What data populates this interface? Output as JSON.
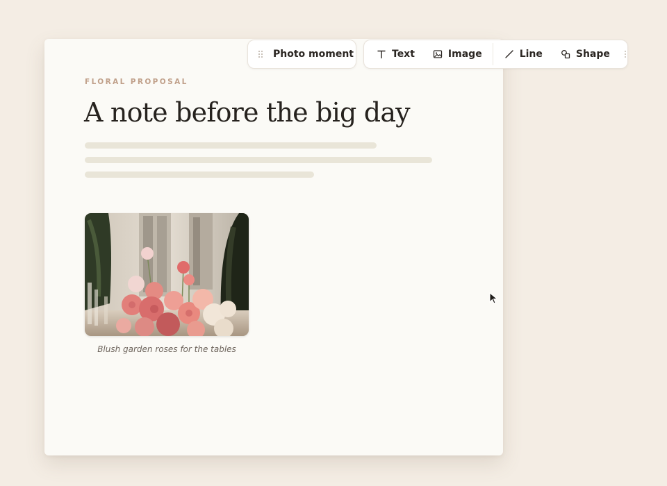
{
  "document": {
    "eyebrow": "FLORAL PROPOSAL",
    "title": "A note before the big day",
    "photo": {
      "caption": "Blush garden roses for the tables",
      "content_description_icon": "photo-icon"
    }
  },
  "selection_pill": {
    "label": "Photo moment",
    "icon": "drag-handle-icon"
  },
  "toolbar": {
    "items": [
      {
        "label": "Text",
        "icon": "text-icon"
      },
      {
        "label": "Image",
        "icon": "image-icon"
      },
      {
        "label": "Line",
        "icon": "line-icon"
      },
      {
        "label": "Shape",
        "icon": "shape-icon"
      }
    ],
    "more_icon": "more-vertical-icon"
  },
  "colors": {
    "background": "#f4ede4",
    "page": "#fbfaf6",
    "eyebrow": "#c0a08a",
    "skeleton": "#e9e5d8",
    "text": "#2b2622"
  }
}
